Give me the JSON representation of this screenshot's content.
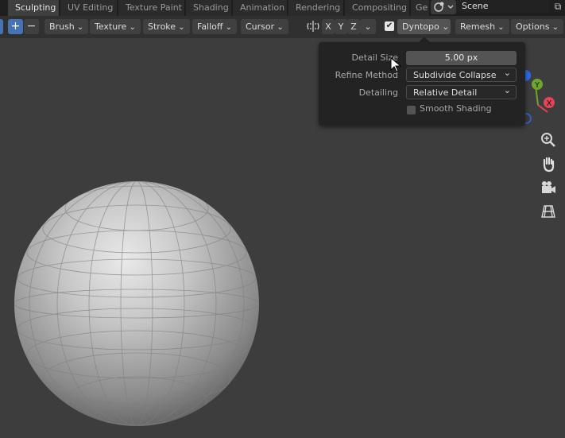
{
  "workspace_tabs": [
    {
      "label": "Sculpting",
      "active": true
    },
    {
      "label": "UV Editing",
      "active": false
    },
    {
      "label": "Texture Paint",
      "active": false
    },
    {
      "label": "Shading",
      "active": false
    },
    {
      "label": "Animation",
      "active": false
    },
    {
      "label": "Rendering",
      "active": false
    },
    {
      "label": "Compositing",
      "active": false
    },
    {
      "label": "Ge",
      "active": false
    }
  ],
  "scene": {
    "name": "Scene"
  },
  "header": {
    "menus": [
      "Brush",
      "Texture",
      "Stroke",
      "Falloff",
      "Cursor"
    ],
    "symmetry_axes": [
      "X",
      "Y",
      "Z"
    ],
    "dyntopo_label": "Dyntopo",
    "dyntopo_enabled": true,
    "remesh_label": "Remesh",
    "options_label": "Options"
  },
  "dyntopo_popover": {
    "detail_size_label": "Detail Size",
    "detail_size_value": "5.00 px",
    "refine_method_label": "Refine Method",
    "refine_method_value": "Subdivide Collapse",
    "detailing_label": "Detailing",
    "detailing_value": "Relative Detail",
    "smooth_shading_label": "Smooth Shading",
    "smooth_shading_checked": false
  },
  "gizmo_axes": {
    "y": "Y",
    "x": "X"
  },
  "nav_icons": [
    "zoom-icon",
    "hand-pan-icon",
    "camera-icon",
    "grid-ortho-icon"
  ],
  "colors": {
    "accent": "#4772b3",
    "x_axis": "#e34456",
    "y_axis": "#6ea52d",
    "z_axis": "#2d6ae3",
    "viewport_bg": "#3d3d3d"
  }
}
